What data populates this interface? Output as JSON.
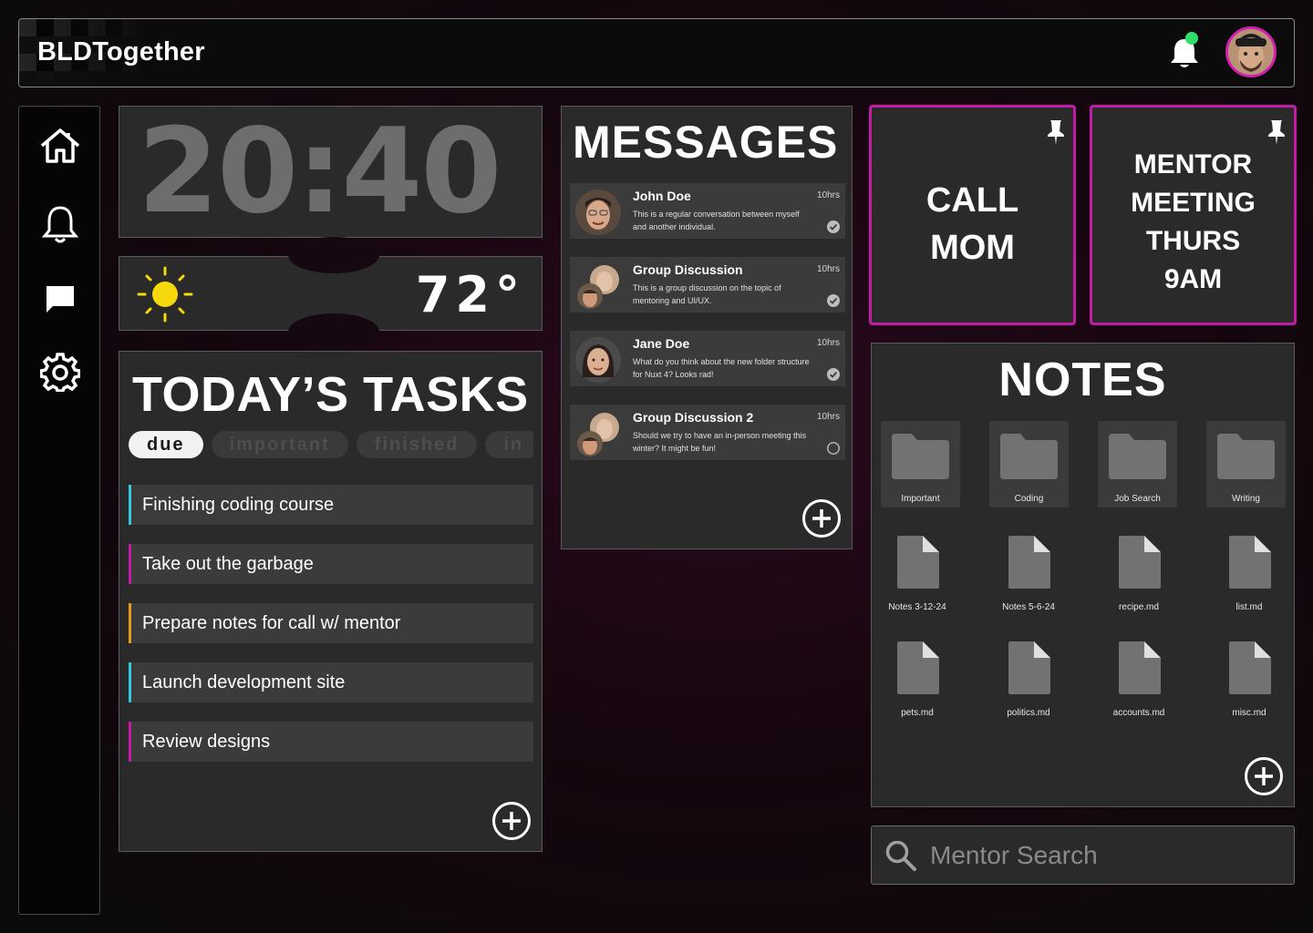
{
  "app": {
    "name": "BLDTogether"
  },
  "header": {
    "notification_dot_color": "#2ee06a",
    "avatar_ring_color": "#d21fb0"
  },
  "sidebar": {
    "items": [
      "home-icon",
      "bell-icon",
      "chat-icon",
      "gear-icon"
    ]
  },
  "clock": {
    "time": "20:40"
  },
  "weather": {
    "icon": "sun-icon",
    "temperature": "72°"
  },
  "tasks": {
    "title": "TODAY’S TASKS",
    "filters": [
      "due",
      "important",
      "finished",
      "in"
    ],
    "active_filter": "due",
    "items": [
      {
        "label": "Finishing coding course",
        "color": "#37c8e0"
      },
      {
        "label": "Take out the garbage",
        "color": "#c51aa8"
      },
      {
        "label": "Prepare notes for call w/ mentor",
        "color": "#e89a1c"
      },
      {
        "label": "Launch development site",
        "color": "#37c8e0"
      },
      {
        "label": "Review designs",
        "color": "#c51aa8"
      }
    ]
  },
  "messages": {
    "title": "MESSAGES",
    "items": [
      {
        "name": "John Doe",
        "time": "10hrs",
        "body": "This is a regular conversation between myself and another individual.",
        "read": true
      },
      {
        "name": "Group Discussion",
        "time": "10hrs",
        "body": "This is a group discussion on the topic of mentoring and UI/UX.",
        "read": true
      },
      {
        "name": "Jane Doe",
        "time": "10hrs",
        "body": "What do you think about the new folder structure for Nuxt 4? Looks rad!",
        "read": true
      },
      {
        "name": "Group Discussion 2",
        "time": "10hrs",
        "body": "Should we try to have an in-person meeting this winter? It might be fun!",
        "read": false
      }
    ]
  },
  "stickies": [
    {
      "lines": [
        "CALL",
        "MOM"
      ]
    },
    {
      "lines": [
        "MENTOR",
        "MEETING",
        "THURS",
        "9AM"
      ]
    }
  ],
  "notes": {
    "title": "NOTES",
    "folders": [
      "Important",
      "Coding",
      "Job Search",
      "Writing"
    ],
    "files": [
      "Notes 3-12-24",
      "Notes 5-6-24",
      "recipe.md",
      "list.md",
      "pets.md",
      "politics.md",
      "accounts.md",
      "misc.md"
    ]
  },
  "search": {
    "placeholder": "Mentor Search"
  }
}
